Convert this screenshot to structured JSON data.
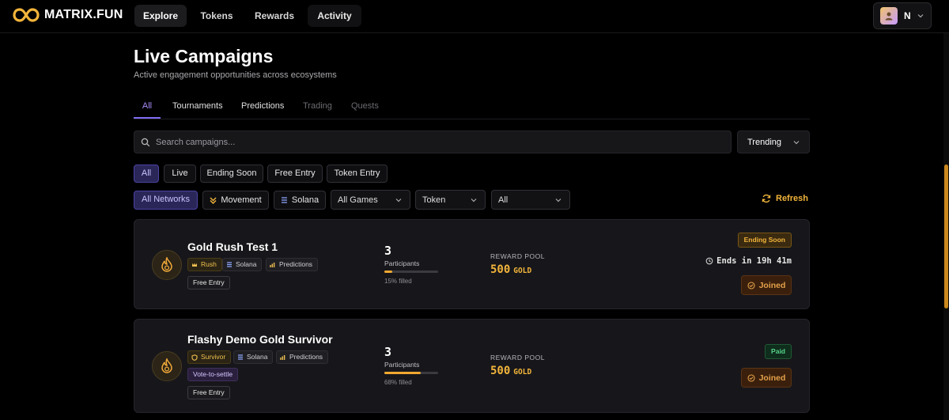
{
  "brand": {
    "name": "MATRIX.FUN"
  },
  "nav": {
    "tabs": [
      {
        "label": "Explore"
      },
      {
        "label": "Tokens"
      },
      {
        "label": "Rewards"
      },
      {
        "label": "Activity"
      }
    ],
    "user_initial": "N"
  },
  "page": {
    "title": "Live Campaigns",
    "subtitle": "Active engagement opportunities across ecosystems"
  },
  "category_tabs": [
    {
      "label": "All"
    },
    {
      "label": "Tournaments"
    },
    {
      "label": "Predictions"
    },
    {
      "label": "Trading"
    },
    {
      "label": "Quests"
    }
  ],
  "search": {
    "placeholder": "Search campaigns...",
    "value": ""
  },
  "sort": {
    "selected": "Trending"
  },
  "status_filters": [
    {
      "label": "All"
    },
    {
      "label": "Live"
    },
    {
      "label": "Ending Soon"
    },
    {
      "label": "Free Entry"
    },
    {
      "label": "Token Entry"
    }
  ],
  "network_filters": [
    {
      "label": "All Networks"
    },
    {
      "label": "Movement"
    },
    {
      "label": "Solana"
    }
  ],
  "dropdowns": [
    {
      "selected": "All Games"
    },
    {
      "selected": "Token"
    },
    {
      "selected": "All"
    }
  ],
  "refresh_label": "Refresh",
  "campaigns": [
    {
      "title": "Gold Rush Test 1",
      "tags": [
        "Rush",
        "Solana",
        "Predictions"
      ],
      "entry": "Free Entry",
      "participants": "3",
      "participants_label": "Participants",
      "fill_fraction": 0.15,
      "filled_text": "15% filled",
      "pool_label": "REWARD POOL",
      "pool_value": "500",
      "pool_unit": "GOLD",
      "status": "Ending Soon",
      "ends": "Ends in 19h 41m",
      "action": "Joined"
    },
    {
      "title": "Flashy Demo Gold Survivor",
      "tags": [
        "Survivor",
        "Solana",
        "Predictions"
      ],
      "extra_tag": "Vote-to-settle",
      "entry": "Free Entry",
      "participants": "3",
      "participants_label": "Participants",
      "fill_fraction": 0.68,
      "filled_text": "68% filled",
      "pool_label": "REWARD POOL",
      "pool_value": "500",
      "pool_unit": "GOLD",
      "status": "Paid",
      "action": "Joined"
    }
  ],
  "colors": {
    "accent": "#f2b43a",
    "active_tab": "#a78bfa",
    "paid": "#56d38a"
  }
}
